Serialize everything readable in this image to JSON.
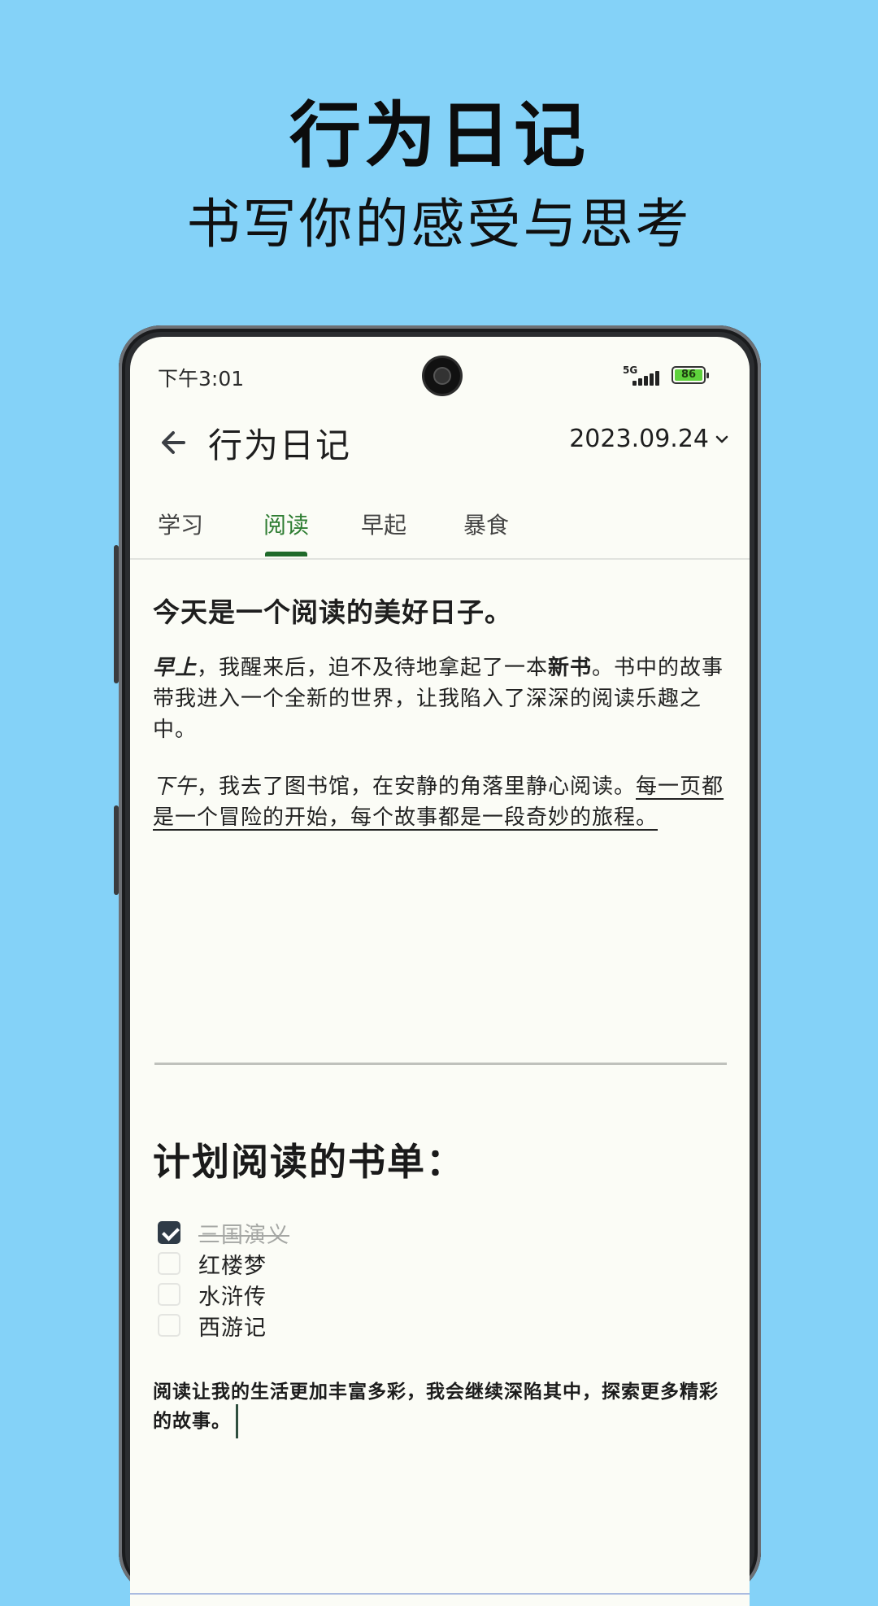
{
  "promo": {
    "title": "行为日记",
    "subtitle": "书写你的感受与思考"
  },
  "status_bar": {
    "time": "下午3:01",
    "network": "5G",
    "battery": "86"
  },
  "app_bar": {
    "back_icon": "arrow-left-icon",
    "title": "行为日记",
    "date": "2023.09.24",
    "date_icon": "chevron-down-icon"
  },
  "tabs": [
    {
      "label": "学习",
      "active": false
    },
    {
      "label": "阅读",
      "active": true
    },
    {
      "label": "早起",
      "active": false
    },
    {
      "label": "暴食",
      "active": false
    }
  ],
  "entry": {
    "heading": "今天是一个阅读的美好日子。",
    "para1": {
      "lead": "早上",
      "text_a": "，我醒来后，迫不及待地拿起了一本",
      "bold": "新书",
      "text_b": "。书中的故事带我进入一个全新的世界，让我陷入了深深的阅读乐趣之中。"
    },
    "para2": {
      "lead": "下午",
      "text": "，我去了图书馆，在安静的角落里静心阅读。",
      "underlined": "每一页都是一个冒险的开始，每个故事都是一段奇妙的旅程。"
    },
    "plan_heading": "计划阅读的书单：",
    "checklist": [
      {
        "label": "三国演义",
        "checked": true
      },
      {
        "label": "红楼梦",
        "checked": false
      },
      {
        "label": "水浒传",
        "checked": false
      },
      {
        "label": "西游记",
        "checked": false
      }
    ],
    "closing": "阅读让我的生活更加丰富多彩，我会继续深陷其中，探索更多精彩的故事。"
  },
  "colors": {
    "background": "#84d2f8",
    "screen": "#fbfcf6",
    "tab_active": "#2e7d32",
    "checkbox_checked": "#2f3b47"
  }
}
